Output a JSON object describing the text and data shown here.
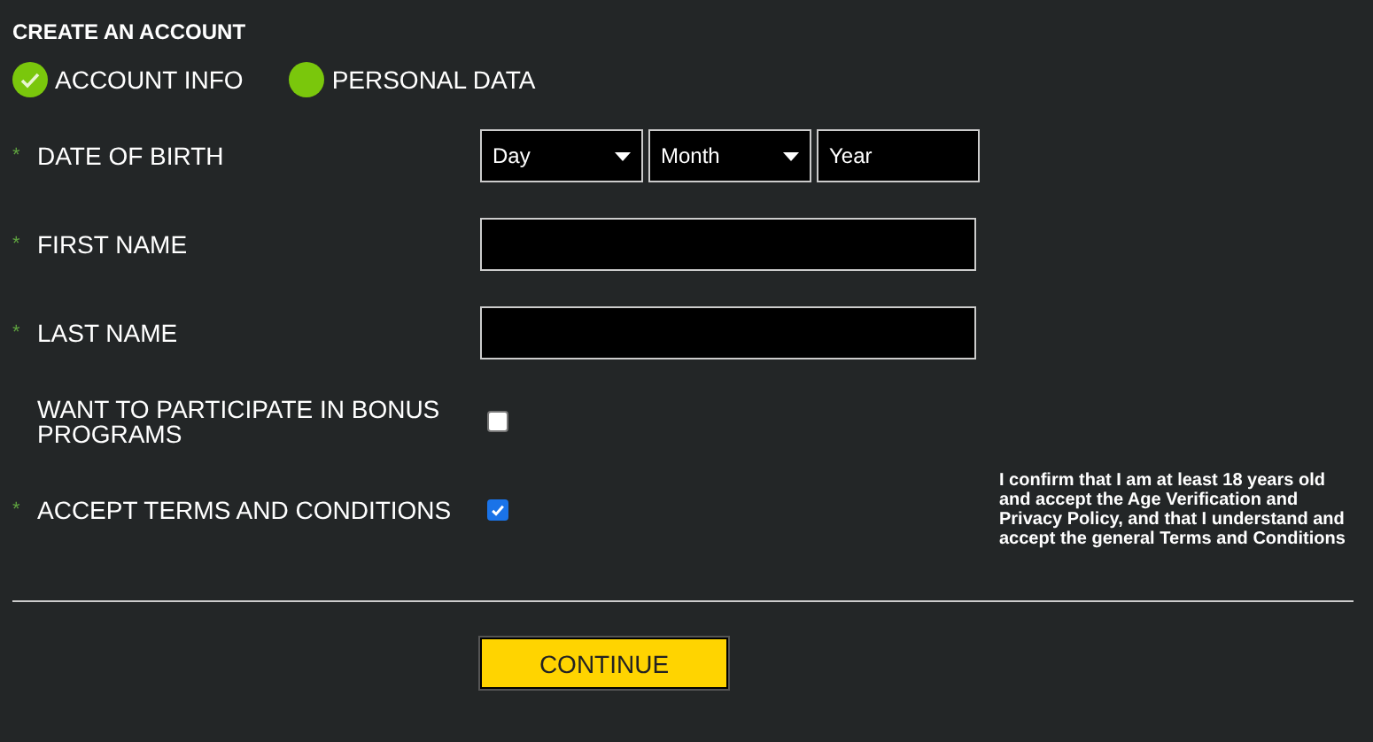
{
  "title": "CREATE AN ACCOUNT",
  "steps": [
    {
      "label": "ACCOUNT INFO",
      "completed": true
    },
    {
      "label": "PERSONAL DATA",
      "completed": false
    }
  ],
  "rows": [
    {
      "kind": "date",
      "mark": "*",
      "label": "DATE OF BIRTH",
      "selects": [
        {
          "value": "Day",
          "dropdown": true
        },
        {
          "value": "Month",
          "dropdown": true
        },
        {
          "value": "Year",
          "dropdown": false
        }
      ]
    },
    {
      "kind": "text",
      "mark": "*",
      "label": "FIRST NAME"
    },
    {
      "kind": "text",
      "mark": "*",
      "label": "LAST NAME"
    },
    {
      "kind": "checkbox",
      "label": "WANT TO PARTICIPATE IN BONUS PROGRAMS",
      "checked": false
    },
    {
      "kind": "checkbox",
      "mark": "*",
      "label": "ACCEPT TERMS AND CONDITIONS",
      "checked": true,
      "note": "I confirm that I am at least 18 years old and accept the Age Verification and Privacy Policy, and that I understand and accept the general Terms and Conditions"
    }
  ],
  "button": "CONTINUE"
}
